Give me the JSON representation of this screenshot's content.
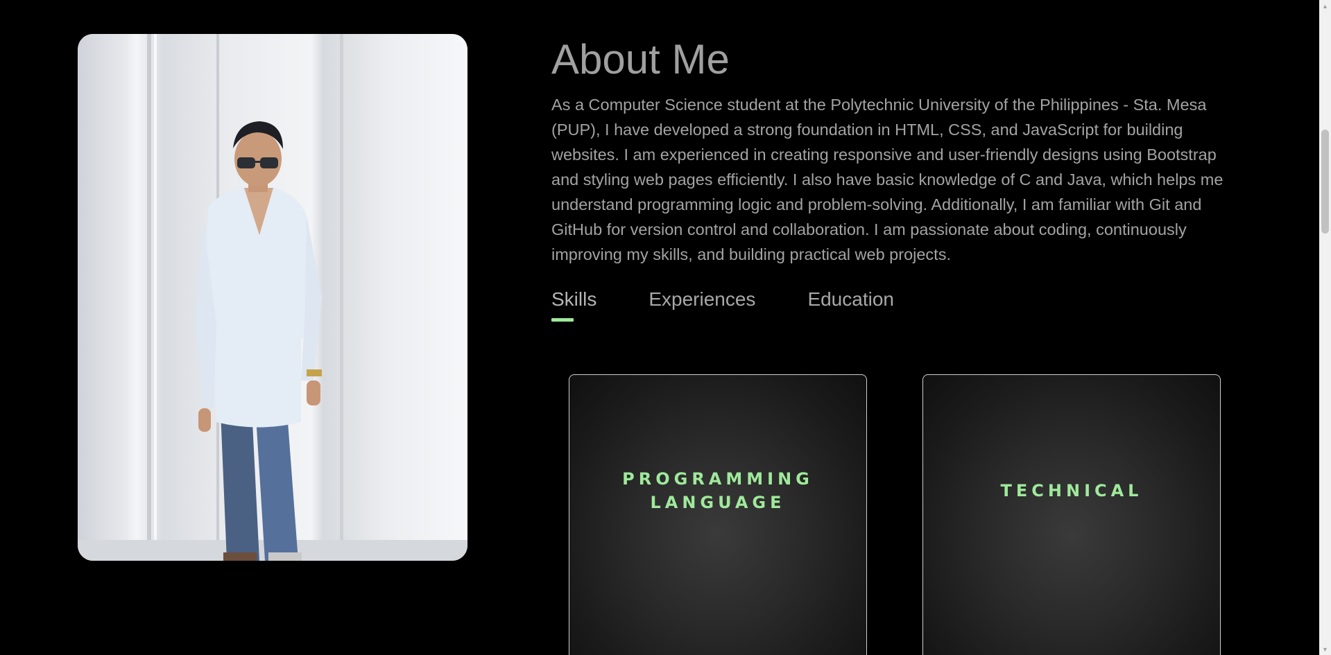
{
  "about": {
    "title": "About Me",
    "description": "As a Computer Science student at the Polytechnic University of the Philippines - Sta. Mesa (PUP), I have developed a strong foundation in HTML, CSS, and JavaScript for building websites. I am experienced in creating responsive and user-friendly designs using Bootstrap and styling web pages efficiently. I also have basic knowledge of C and Java, which helps me understand programming logic and problem-solving. Additionally, I am familiar with Git and GitHub for version control and collaboration. I am passionate about coding, continuously improving my skills, and building practical web projects."
  },
  "tabs": [
    {
      "label": "Skills",
      "active": true
    },
    {
      "label": "Experiences",
      "active": false
    },
    {
      "label": "Education",
      "active": false
    }
  ],
  "cards": [
    {
      "title": "PROGRAMMING\nLANGUAGE"
    },
    {
      "title": "TECHNICAL"
    }
  ],
  "colors": {
    "background": "#000000",
    "accent": "#9fe99b",
    "text": "#a3a3a3"
  },
  "icons": {
    "scroll_up": "triangle-up-icon",
    "scroll_down": "triangle-down-icon"
  }
}
